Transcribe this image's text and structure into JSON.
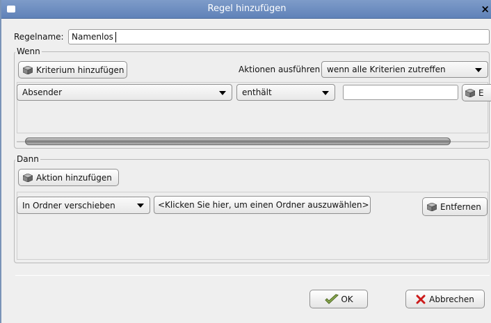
{
  "window": {
    "title": "Regel hinzufügen",
    "close_glyph": "×"
  },
  "rule_name": {
    "label": "Regelname:",
    "value": "Namenlos"
  },
  "when_section": {
    "legend": "Wenn",
    "add_criterion_label": "Kriterium hinzufügen",
    "execute_actions_label": "Aktionen ausführen",
    "match_mode": "wenn alle Kriterien zutreffen",
    "criterion": {
      "field": "Absender",
      "operator": "enthält",
      "value": "",
      "remove_label_partial": "E"
    }
  },
  "then_section": {
    "legend": "Dann",
    "add_action_label": "Aktion hinzufügen",
    "action": {
      "type": "In Ordner verschieben",
      "folder_button": "<Klicken Sie hier, um einen Ordner auszuwählen>",
      "remove_label": "Entfernen"
    }
  },
  "footer": {
    "ok_label": "OK",
    "cancel_label": "Abbrechen"
  },
  "icons": {
    "add": "package-icon",
    "ok": "checkmark-icon",
    "cancel": "red-x-icon"
  },
  "colors": {
    "title_bar": "#6f8fc2",
    "cancel_icon": "#cc1a1a",
    "ok_icon": "#6a8a3a"
  }
}
